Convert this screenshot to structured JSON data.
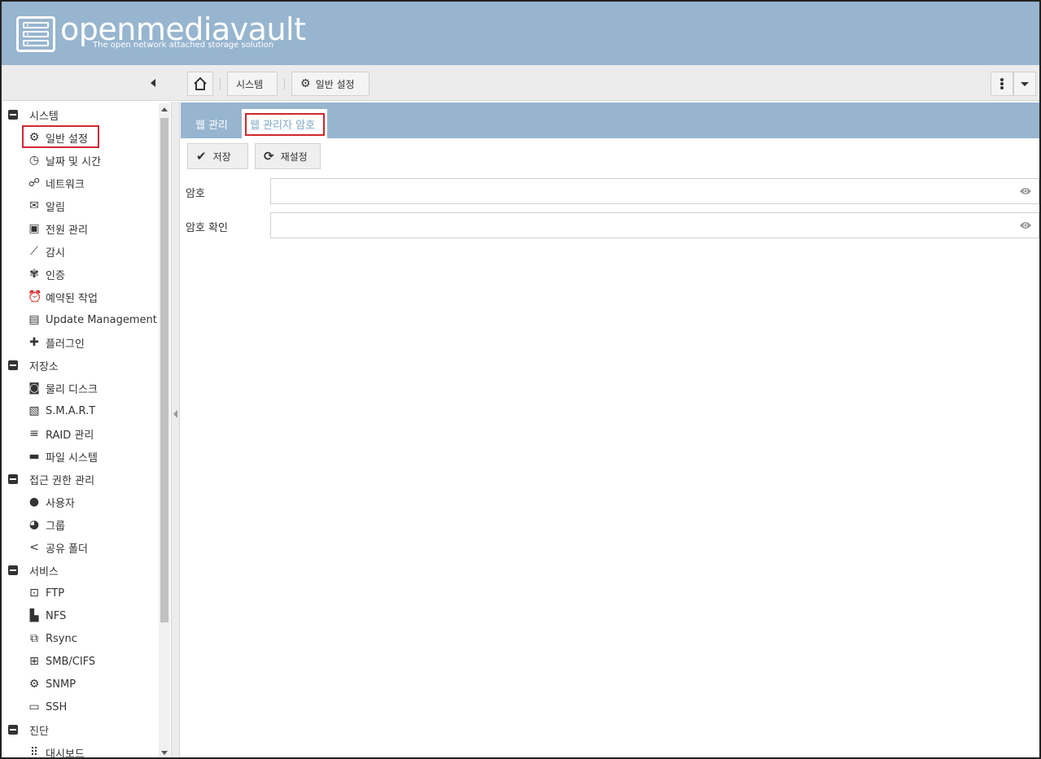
{
  "header": {
    "title": "openmediavault",
    "subtitle": "The open network attached storage solution"
  },
  "breadcrumb": {
    "items": [
      "시스템",
      "일반 설정"
    ]
  },
  "sidebar": {
    "groups": [
      {
        "label": "시스템",
        "items": [
          {
            "label": "일반 설정",
            "icon": "gears-icon",
            "selected": true
          },
          {
            "label": "날짜 및 시간",
            "icon": "clock-icon"
          },
          {
            "label": "네트워크",
            "icon": "network-icon"
          },
          {
            "label": "알림",
            "icon": "envelope-icon"
          },
          {
            "label": "전원 관리",
            "icon": "power-icon"
          },
          {
            "label": "감시",
            "icon": "chart-line-icon"
          },
          {
            "label": "인증",
            "icon": "certificate-icon"
          },
          {
            "label": "예약된 작업",
            "icon": "alarm-clock-icon"
          },
          {
            "label": "Update Management",
            "icon": "archive-icon"
          },
          {
            "label": "플러그인",
            "icon": "puzzle-icon"
          }
        ]
      },
      {
        "label": "저장소",
        "items": [
          {
            "label": "물리 디스크",
            "icon": "disk-icon"
          },
          {
            "label": "S.M.A.R.T",
            "icon": "heartbeat-icon"
          },
          {
            "label": "RAID 관리",
            "icon": "database-icon"
          },
          {
            "label": "파일 시스템",
            "icon": "folder-icon"
          }
        ]
      },
      {
        "label": "접근 권한 관리",
        "items": [
          {
            "label": "사용자",
            "icon": "user-icon"
          },
          {
            "label": "그룹",
            "icon": "users-icon"
          },
          {
            "label": "공유 폴더",
            "icon": "share-icon"
          }
        ]
      },
      {
        "label": "서비스",
        "items": [
          {
            "label": "FTP",
            "icon": "ftp-icon"
          },
          {
            "label": "NFS",
            "icon": "nfs-icon"
          },
          {
            "label": "Rsync",
            "icon": "rsync-icon"
          },
          {
            "label": "SMB/CIFS",
            "icon": "windows-icon"
          },
          {
            "label": "SNMP",
            "icon": "snmp-icon"
          },
          {
            "label": "SSH",
            "icon": "terminal-icon"
          }
        ]
      },
      {
        "label": "진단",
        "items": [
          {
            "label": "대시보드",
            "icon": "grid-icon"
          }
        ]
      }
    ]
  },
  "tabs": [
    {
      "label": "웹 관리",
      "active": false
    },
    {
      "label": "웹 관리자 암호",
      "active": true
    }
  ],
  "actions": {
    "save_label": "저장",
    "reset_label": "재설정"
  },
  "form": {
    "password_label": "암호",
    "password_value": "",
    "confirm_label": "암호 확인",
    "confirm_value": ""
  },
  "colors": {
    "header_bg": "#97b5cf",
    "highlight_border": "#d0282f",
    "active_tab_text": "#7fa6c7"
  }
}
